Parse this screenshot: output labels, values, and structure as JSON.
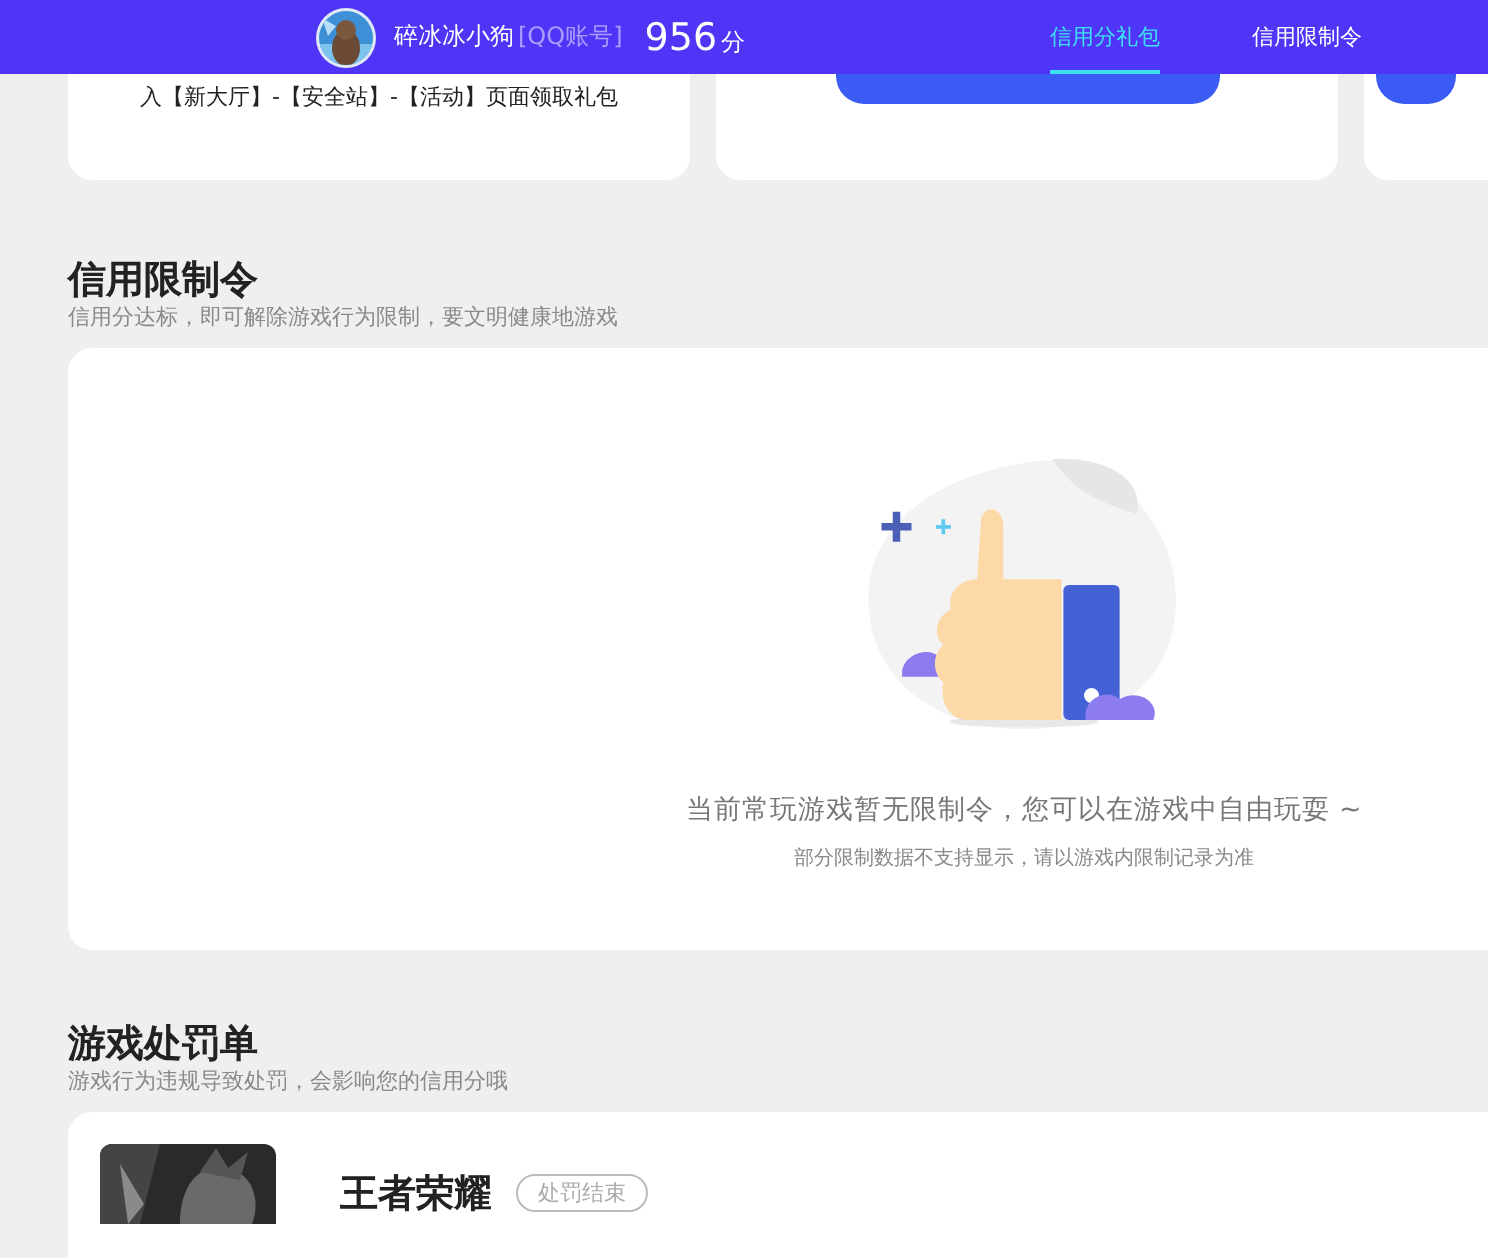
{
  "header": {
    "username": "碎冰冰小狗",
    "account_type": "[QQ账号]",
    "score": "956",
    "score_unit": "分",
    "tabs": [
      {
        "label": "信用分礼包",
        "selected": true
      },
      {
        "label": "信用限制令",
        "selected": false
      }
    ]
  },
  "gift_cards": [
    {
      "kind": "text",
      "text": "入【新大厅】-【安全站】-【活动】页面领取礼包"
    },
    {
      "kind": "button"
    },
    {
      "kind": "button"
    }
  ],
  "restriction": {
    "title": "信用限制令",
    "subtitle": "信用分达标，即可解除游戏行为限制，要文明健康地游戏",
    "empty_message": "当前常玩游戏暂无限制令，您可以在游戏中自由玩耍 ~",
    "note": "部分限制数据不支持显示，请以游戏内限制记录为准"
  },
  "penalties": {
    "title": "游戏处罚单",
    "subtitle": "游戏行为违规导致处罚，会影响您的信用分哦",
    "items": [
      {
        "game": "王者荣耀",
        "status": "处罚结束",
        "ended": true
      }
    ]
  }
}
